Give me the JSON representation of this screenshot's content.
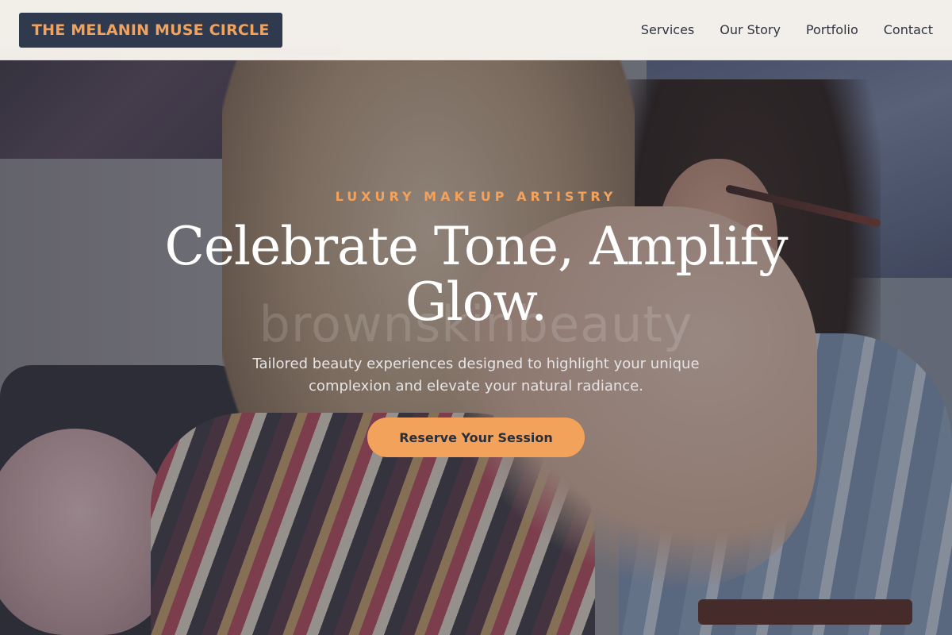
{
  "nav": {
    "brand": "THE MELANIN MUSE CIRCLE",
    "links": [
      "Services",
      "Our Story",
      "Portfolio",
      "Contact"
    ]
  },
  "hero": {
    "eyebrow": "LUXURY MAKEUP ARTISTRY",
    "headline": "Celebrate Tone, Amplify Glow.",
    "watermark": "brownskinbeauty",
    "subtitle": "Tailored beauty experiences designed to highlight your unique complexion and elevate your natural radiance.",
    "cta_label": "Reserve Your Session"
  },
  "colors": {
    "accent": "#f3a25c",
    "brand_box": "#2f3a4e",
    "nav_bg": "#f7f3ec",
    "text_dark": "#2f3440"
  }
}
